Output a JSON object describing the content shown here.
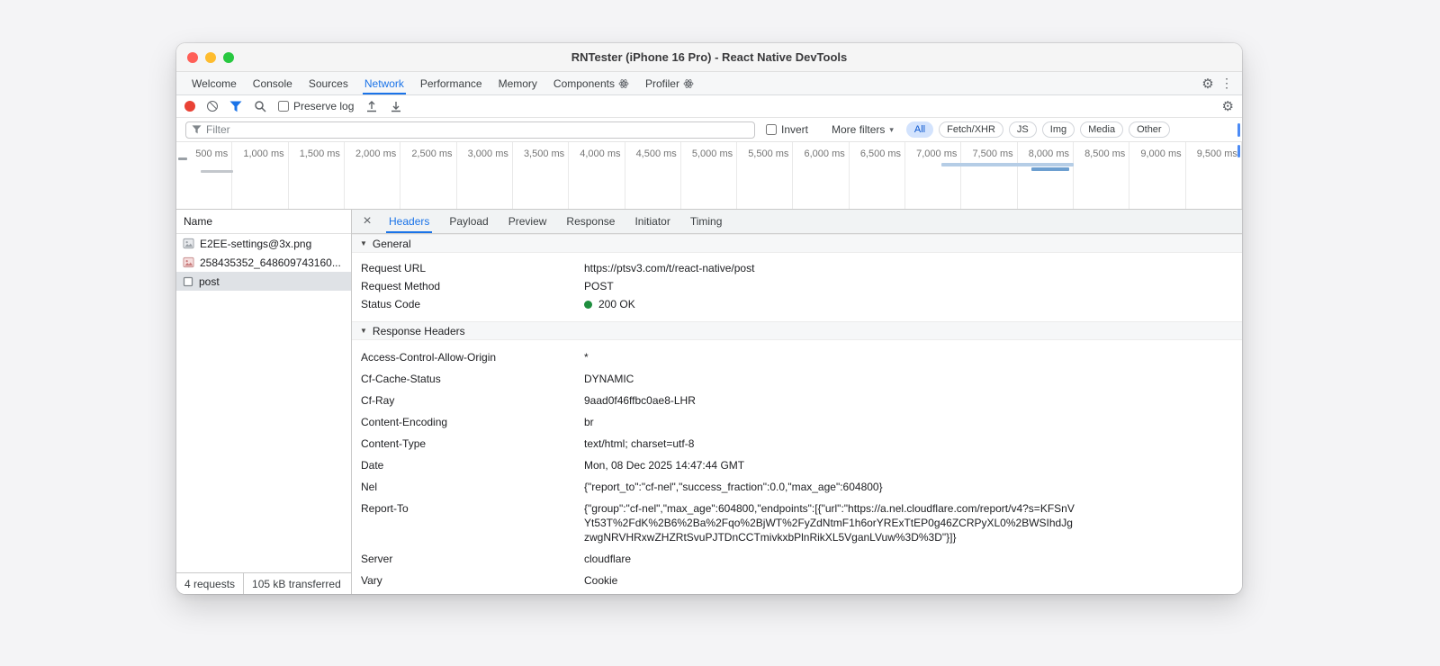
{
  "window": {
    "title": "RNTester (iPhone 16 Pro) - React Native DevTools"
  },
  "icons": {
    "gear": "⚙",
    "kebab": "⋮",
    "caret": "▾",
    "disclosure": "▼",
    "close": "×"
  },
  "main_tabs": {
    "active": "Network",
    "items": [
      {
        "label": "Welcome"
      },
      {
        "label": "Console"
      },
      {
        "label": "Sources"
      },
      {
        "label": "Network"
      },
      {
        "label": "Performance"
      },
      {
        "label": "Memory"
      },
      {
        "label": "Components"
      },
      {
        "label": "Profiler"
      }
    ]
  },
  "network_toolbar": {
    "preserve_log": "Preserve log"
  },
  "filter_bar": {
    "placeholder": "Filter",
    "invert": "Invert",
    "more_filters": "More filters",
    "pills": {
      "all": "All",
      "fetch": "Fetch/XHR",
      "js": "JS",
      "img": "Img",
      "media": "Media",
      "other": "Other"
    },
    "selected_pill": "All"
  },
  "timeline": {
    "ticks": [
      "500 ms",
      "1,000 ms",
      "1,500 ms",
      "2,000 ms",
      "2,500 ms",
      "3,000 ms",
      "3,500 ms",
      "4,000 ms",
      "4,500 ms",
      "5,000 ms",
      "5,500 ms",
      "6,000 ms",
      "6,500 ms",
      "7,000 ms",
      "7,500 ms",
      "8,000 ms",
      "8,500 ms",
      "9,000 ms",
      "9,500 ms"
    ]
  },
  "request_list": {
    "header": "Name",
    "items": [
      {
        "name": "E2EE-settings@3x.png",
        "icon": "image"
      },
      {
        "name": "258435352_648609743160...",
        "icon": "image"
      },
      {
        "name": "post",
        "icon": "document",
        "selected": true
      }
    ]
  },
  "summary": {
    "requests": "4 requests",
    "transferred": "105 kB transferred"
  },
  "detail": {
    "tabs": [
      "Headers",
      "Payload",
      "Preview",
      "Response",
      "Initiator",
      "Timing"
    ],
    "active_tab": "Headers",
    "general": {
      "title": "General",
      "rows": [
        {
          "name": "Request URL",
          "value": "https://ptsv3.com/t/react-native/post"
        },
        {
          "name": "Request Method",
          "value": "POST"
        },
        {
          "name": "Status Code",
          "value": "200 OK",
          "status_color": "#1e8e3e"
        }
      ]
    },
    "response_headers": {
      "title": "Response Headers",
      "rows": [
        {
          "name": "Access-Control-Allow-Origin",
          "value": "*"
        },
        {
          "name": "Cf-Cache-Status",
          "value": "DYNAMIC"
        },
        {
          "name": "Cf-Ray",
          "value": "9aad0f46ffbc0ae8-LHR"
        },
        {
          "name": "Content-Encoding",
          "value": "br"
        },
        {
          "name": "Content-Type",
          "value": "text/html; charset=utf-8"
        },
        {
          "name": "Date",
          "value": "Mon, 08 Dec 2025 14:47:44 GMT"
        },
        {
          "name": "Nel",
          "value": "{\"report_to\":\"cf-nel\",\"success_fraction\":0.0,\"max_age\":604800}"
        },
        {
          "name": "Report-To",
          "value": "{\"group\":\"cf-nel\",\"max_age\":604800,\"endpoints\":[{\"url\":\"https://a.nel.cloudflare.com/report/v4?s=KFSnVYt53T%2FdK%2B6%2Ba%2Fqo%2BjWT%2FyZdNtmF1h6orYRExTtEP0g46ZCRPyXL0%2BWSIhdJgzwgNRVHRxwZHZRtSvuPJTDnCCTmivkxbPlnRikXL5VganLVuw%3D%3D\"}]}"
        },
        {
          "name": "Server",
          "value": "cloudflare"
        },
        {
          "name": "Vary",
          "value": "Cookie"
        }
      ]
    }
  },
  "colors": {
    "accent": "#1a73e8",
    "selected_pill_bg": "#d3e3fd",
    "status_ok": "#1e8e3e",
    "record": "#e94235"
  }
}
